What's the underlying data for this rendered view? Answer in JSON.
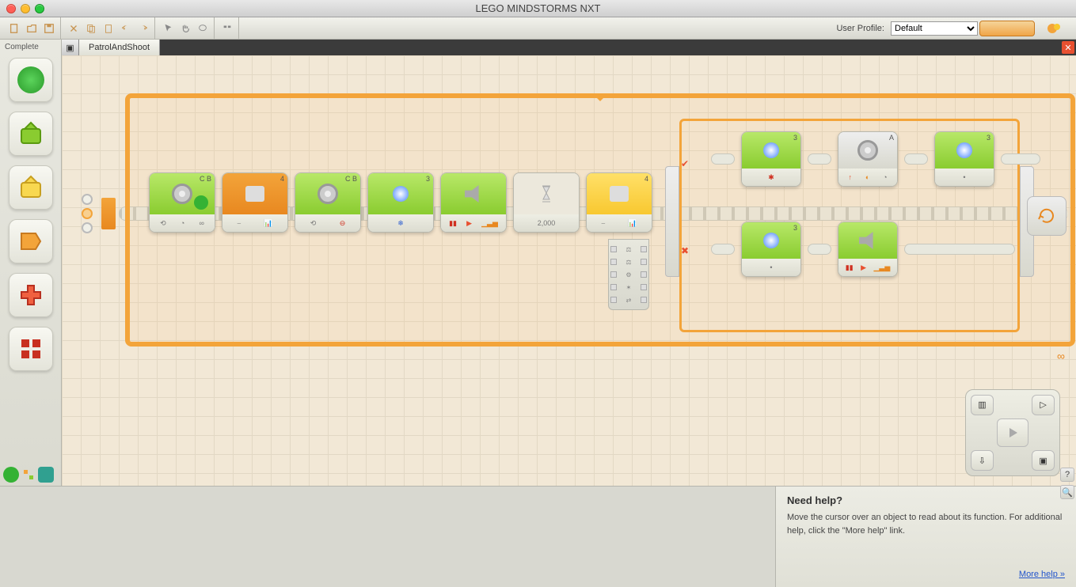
{
  "app": {
    "title": "LEGO MINDSTORMS NXT"
  },
  "toolbar": {
    "profile_label": "User Profile:",
    "profile_value": "Default"
  },
  "palette": {
    "heading": "Complete",
    "items": [
      {
        "name": "common-green-circle",
        "color": "#34b234"
      },
      {
        "name": "action-green-arrow",
        "color": "#8acc30"
      },
      {
        "name": "sensor-yellow-arrow",
        "color": "#f8c830"
      },
      {
        "name": "flow-orange",
        "color": "#f3a43a"
      },
      {
        "name": "data-red-plus",
        "color": "#e85030"
      },
      {
        "name": "advanced-red-grid",
        "color": "#c83020"
      }
    ]
  },
  "tab": {
    "name": "PatrolAndShoot"
  },
  "blocks": [
    {
      "type": "move",
      "port": "C B",
      "icon": "gear",
      "bottom": "unlimited"
    },
    {
      "type": "motor",
      "port": "4",
      "icon": "sensor",
      "bottom": "wait"
    },
    {
      "type": "move",
      "port": "C B",
      "icon": "gear",
      "bottom": "stop"
    },
    {
      "type": "light",
      "port": "3",
      "icon": "bulb",
      "bottom": "color"
    },
    {
      "type": "sound",
      "port": "",
      "icon": "speaker",
      "bottom": "play"
    },
    {
      "type": "wait",
      "port": "",
      "icon": "hourglass",
      "bottom": "2,000"
    },
    {
      "type": "sensor",
      "port": "4",
      "icon": "ultrasonic",
      "bottom": "compare"
    }
  ],
  "switch": {
    "true_branch": [
      {
        "type": "light",
        "port": "3",
        "icon": "bulb"
      },
      {
        "type": "motor",
        "port": "A",
        "icon": "gear"
      },
      {
        "type": "light",
        "port": "3",
        "icon": "bulb"
      }
    ],
    "false_branch": [
      {
        "type": "light",
        "port": "3",
        "icon": "bulb"
      },
      {
        "type": "sound",
        "port": "",
        "icon": "speaker"
      }
    ]
  },
  "help": {
    "title": "Need help?",
    "body": "Move the cursor over an object to read about its function. For additional help, click the \"More help\" link.",
    "link": "More help »"
  }
}
